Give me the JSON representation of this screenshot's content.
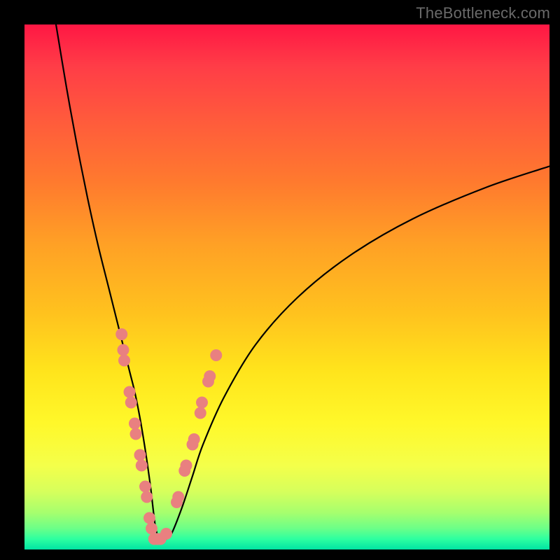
{
  "watermark": {
    "text": "TheBottleneck.com"
  },
  "chart_data": {
    "type": "line",
    "title": "",
    "xlabel": "",
    "ylabel": "",
    "xlim": [
      0,
      100
    ],
    "ylim": [
      0,
      100
    ],
    "series": [
      {
        "name": "curve",
        "x": [
          6,
          8,
          10,
          12,
          14,
          16,
          18,
          20,
          21,
          22,
          23,
          24,
          25,
          26,
          27,
          28,
          30,
          32,
          34,
          38,
          44,
          52,
          62,
          74,
          88,
          100
        ],
        "values": [
          100,
          88,
          77,
          67,
          58,
          50,
          42,
          34,
          30,
          25,
          19,
          12,
          4,
          2,
          2,
          3,
          8,
          14,
          20,
          29,
          39,
          48,
          56,
          63,
          69,
          73
        ]
      }
    ],
    "scatter": {
      "name": "markers",
      "color": "#e98080",
      "points": [
        [
          18.5,
          41
        ],
        [
          18.8,
          38
        ],
        [
          19.0,
          36
        ],
        [
          20.0,
          30
        ],
        [
          20.3,
          28
        ],
        [
          21.0,
          24
        ],
        [
          21.2,
          22
        ],
        [
          22.0,
          18
        ],
        [
          22.3,
          16
        ],
        [
          23.0,
          12
        ],
        [
          23.3,
          10
        ],
        [
          23.8,
          6
        ],
        [
          24.2,
          4
        ],
        [
          24.7,
          2
        ],
        [
          25.3,
          2
        ],
        [
          25.9,
          2
        ],
        [
          27.0,
          3
        ],
        [
          29.0,
          9
        ],
        [
          29.3,
          10
        ],
        [
          30.5,
          15
        ],
        [
          30.8,
          16
        ],
        [
          32.0,
          20
        ],
        [
          32.3,
          21
        ],
        [
          33.5,
          26
        ],
        [
          33.8,
          28
        ],
        [
          35.0,
          32
        ],
        [
          35.3,
          33
        ],
        [
          36.5,
          37
        ]
      ]
    },
    "background_gradient": {
      "stops": [
        {
          "pos": 0.0,
          "color": "#ff1744"
        },
        {
          "pos": 0.3,
          "color": "#ff7a2e"
        },
        {
          "pos": 0.66,
          "color": "#ffe41c"
        },
        {
          "pos": 0.9,
          "color": "#a6ff6e"
        },
        {
          "pos": 1.0,
          "color": "#00e3a3"
        }
      ]
    }
  }
}
